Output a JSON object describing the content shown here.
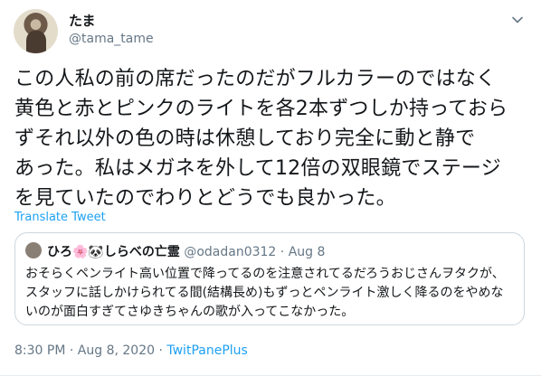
{
  "author": {
    "name": "たま",
    "handle": "@tama_tame"
  },
  "tweet": {
    "text": "この人私の前の席だったのだがフルカラーのではなく\n黄色と赤とピンクのライトを各2本ずつしか持っておら\nずそれ以外の色の時は休憩しており完全に動と静で\nあった。私はメガネを外して12倍の双眼鏡でステージ\nを見ていたのでわりとどうでも良かった。",
    "translate_label": "Translate Tweet"
  },
  "quote": {
    "name": "ひろ🌸🐼しらべの亡霊",
    "handle": "@odadan0312",
    "separator": "·",
    "date": "Aug 8",
    "text": "おそらくペンライト高い位置で降ってるのを注意されてるだろうおじさんヲタクが、スタッフに話しかけられてる間(結構長め)もずっとペンライト激しく降るのをやめないのが面白すぎてさゆきちゃんの歌が入ってこなかった。"
  },
  "meta": {
    "time": "8:30 PM",
    "dot1": "·",
    "date": "Aug 8, 2020",
    "dot2": "·",
    "source": "TwitPanePlus"
  },
  "icons": {
    "menu": "chevron-down-icon",
    "avatar": "avatar-photo"
  },
  "colors": {
    "link": "#1da1f2",
    "secondary_text": "#657786",
    "border": "#ccd6dd"
  }
}
